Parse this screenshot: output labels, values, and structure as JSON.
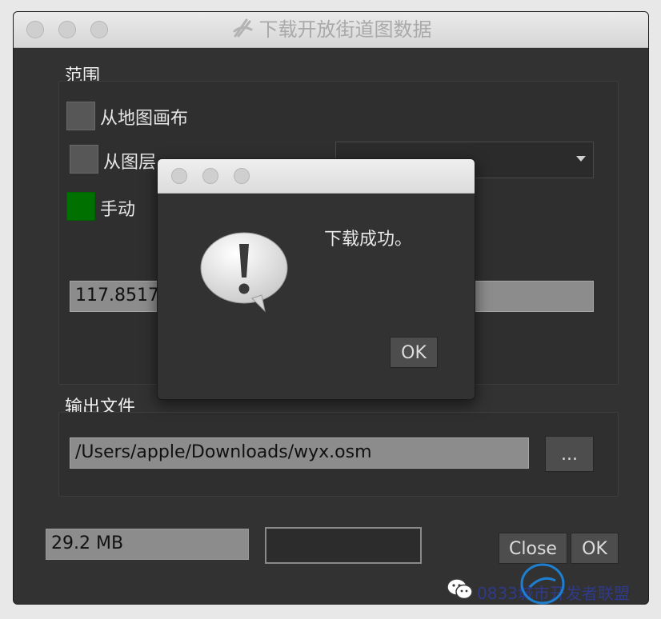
{
  "window": {
    "title": "下载开放街道图数据"
  },
  "extent": {
    "section_title": "范围",
    "options": [
      {
        "label": "从地图画布",
        "checked": false
      },
      {
        "label": "从图层",
        "checked": false
      },
      {
        "label": "手动",
        "checked": true
      }
    ],
    "coord_value": "117.8517"
  },
  "output": {
    "section_title": "输出文件",
    "path": "/Users/apple/Downloads/wyx.osm",
    "browse_label": "..."
  },
  "footer": {
    "size_value": "29.2 MB",
    "close_label": "Close",
    "ok_label": "OK"
  },
  "dialog": {
    "message": "下载成功。",
    "ok_label": "OK"
  },
  "watermark": {
    "text": "0833城市开发者联盟"
  },
  "colors": {
    "checked_green": "#007000",
    "window_bg": "#323232"
  }
}
